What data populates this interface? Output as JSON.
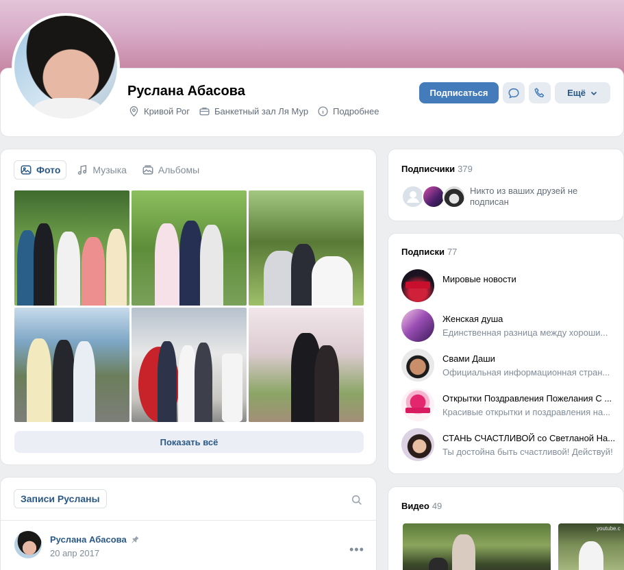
{
  "profile": {
    "name": "Руслана Абасова",
    "city": "Кривой Рог",
    "work": "Банкетный зал Ля Мур",
    "details": "Подробнее"
  },
  "actions": {
    "subscribe": "Подписаться",
    "more": "Ещё"
  },
  "media_tabs": {
    "photos": "Фото",
    "music": "Музыка",
    "albums": "Альбомы"
  },
  "photos": {
    "show_all": "Показать всё"
  },
  "posts": {
    "tab": "Записи Русланы",
    "author": "Руслана Абасова",
    "date": "20 апр 2017"
  },
  "followers": {
    "title": "Подписчики",
    "count": "379",
    "text": "Никто из ваших друзей не подписан"
  },
  "subscriptions": {
    "title": "Подписки",
    "count": "77",
    "items": [
      {
        "name": "Мировые новости",
        "desc": ""
      },
      {
        "name": "Женская душа",
        "desc": "Единственная разница между хороши..."
      },
      {
        "name": "Свами Даши",
        "desc": "Официальная информационная стран..."
      },
      {
        "name": "Открытки Поздравления Пожелания С ...",
        "desc": "Красивые открытки и поздравления на..."
      },
      {
        "name": "СТАНЬ СЧАСТЛИВОЙ со Светланой На...",
        "desc": "Ты достойна быть счастливой! Действуй!"
      }
    ]
  },
  "videos": {
    "title": "Видео",
    "count": "49"
  },
  "colors": {
    "accent": "#447bba",
    "link": "#2a5885",
    "muted": "#818c99"
  }
}
